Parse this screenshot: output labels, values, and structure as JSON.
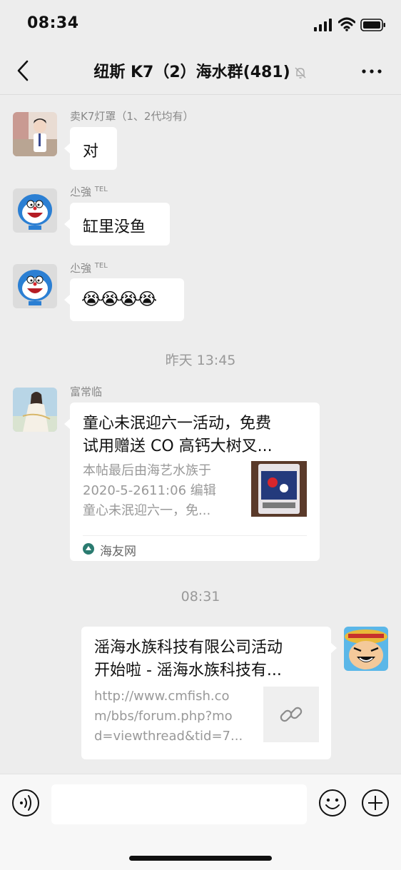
{
  "status": {
    "time": "08:34"
  },
  "header": {
    "title": "纽斯 K7（2）海水群(481)"
  },
  "messages": [
    {
      "sender": "卖K7灯罩（1、2代均有）",
      "text": "对"
    },
    {
      "sender": "尐強",
      "tag": "TEL",
      "text": "缸里没鱼"
    },
    {
      "sender": "尐強",
      "tag": "TEL",
      "text": "😭😭😭😭"
    }
  ],
  "timestamps": {
    "t1": "昨天 13:45",
    "t2": "08:31"
  },
  "link_card": {
    "sender": "富常临",
    "title_line1": "童心未泯迎六一活动，免费",
    "title_line2": "试用赠送 CO 高钙大树叉...",
    "desc_line1": "本帖最后由海艺水族于",
    "desc_line2": "2020-5-2611:06 编辑",
    "desc_line3": "童心未泯迎六一，免...",
    "source": "海友网"
  },
  "own_card": {
    "title_line1": "滛海水族科技有限公司活动",
    "title_line2": "开始啦 - 滛海水族科技有...",
    "url_line1": "http://www.cmfish.co",
    "url_line2": "m/bbs/forum.php?mo",
    "url_line3": "d=viewthread&tid=7..."
  },
  "colors": {
    "background": "#ededed",
    "bubble": "#ffffff",
    "muted_text": "#999999"
  }
}
